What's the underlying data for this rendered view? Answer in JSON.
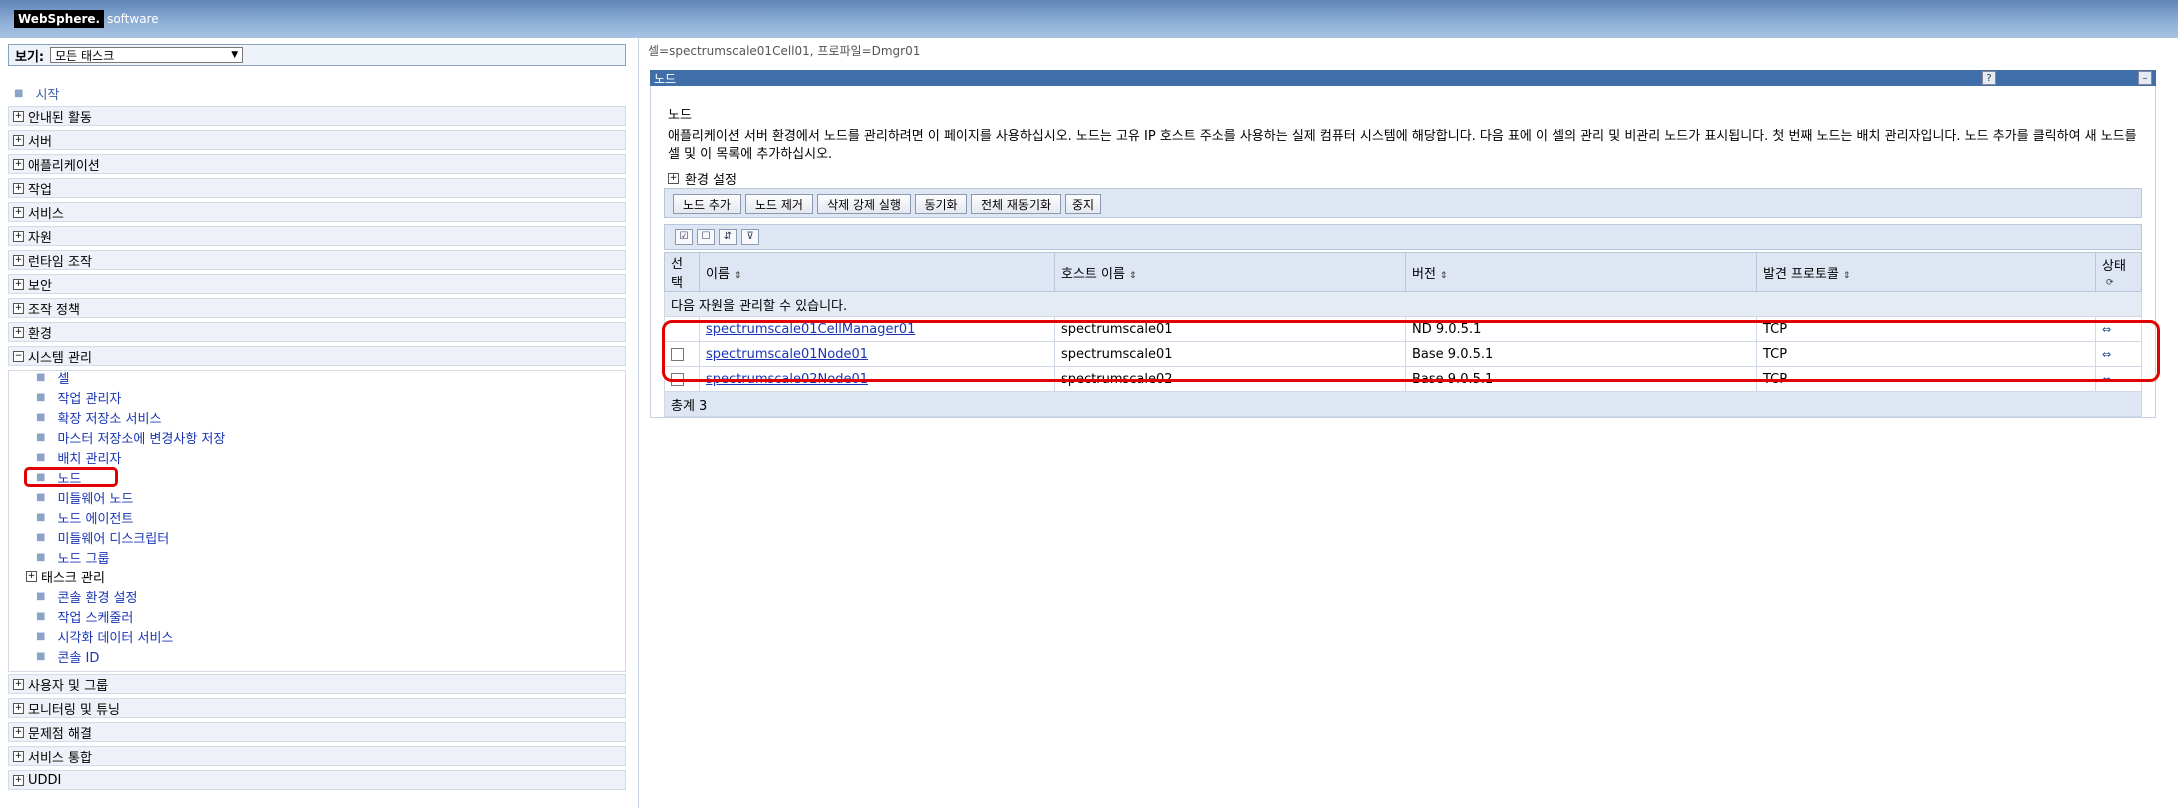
{
  "header": {
    "brand": "WebSphere.",
    "brand_suffix": "software"
  },
  "nav": {
    "view_label": "보기:",
    "view_select": "모든 태스크",
    "start_link": "시작",
    "sections_top": [
      "안내된 활동",
      "서버",
      "애플리케이션",
      "작업",
      "서비스",
      "자원",
      "런타임 조작",
      "보안",
      "조작 정책",
      "환경"
    ],
    "system_admin": "시스템 관리",
    "system_admin_items": [
      "셀",
      "작업 관리자",
      "확장 저장소 서비스",
      "마스터 저장소에 변경사항 저장",
      "배치 관리자",
      "노드",
      "미들웨어 노드",
      "노드 에이전트",
      "미들웨어 디스크립터",
      "노드 그룹"
    ],
    "task_mgmt": "태스크 관리",
    "after_task_items": [
      "콘솔 환경 설정",
      "작업 스케줄러",
      "시각화 데이터 서비스",
      "콘솔 ID"
    ],
    "sections_bottom": [
      "사용자 및 그룹",
      "모니터링 및 튜닝",
      "문제점 해결",
      "서비스 통합",
      "UDDI"
    ]
  },
  "main": {
    "breadcrumb": "셀=spectrumscale01Cell01, 프로파일=Dmgr01",
    "panel_title": "노드",
    "help_icon": "?",
    "minimize_icon": "–",
    "heading": "노드",
    "description": "애플리케이션 서버 환경에서 노드를 관리하려면 이 페이지를 사용하십시오. 노드는 고유 IP 호스트 주소를 사용하는 실제 컴퓨터 시스템에 해당합니다. 다음 표에 이 셀의 관리 및 비관리 노드가 표시됩니다. 첫 번째 노드는 배치 관리자입니다. 노드 추가를 클릭하여 새 노드를 셀 및 이 목록에 추가하십시오.",
    "env_settings": "환경 설정",
    "buttons": [
      "노드 추가",
      "노드 제거",
      "삭제 강제 실행",
      "동기화",
      "전체 재동기화",
      "중지"
    ],
    "columns": [
      "선택",
      "이름",
      "호스트 이름",
      "버전",
      "발견 프로토콜",
      "상태"
    ],
    "info_row": "다음 자원을 관리할 수 있습니다.",
    "rows": [
      {
        "name": "spectrumscale01CellManager01",
        "host": "spectrumscale01",
        "version": "ND 9.0.5.1",
        "protocol": "TCP"
      },
      {
        "name": "spectrumscale01Node01",
        "host": "spectrumscale01",
        "version": "Base 9.0.5.1",
        "protocol": "TCP"
      },
      {
        "name": "spectrumscale02Node01",
        "host": "spectrumscale02",
        "version": "Base 9.0.5.1",
        "protocol": "TCP"
      }
    ],
    "total": "총계 3"
  }
}
